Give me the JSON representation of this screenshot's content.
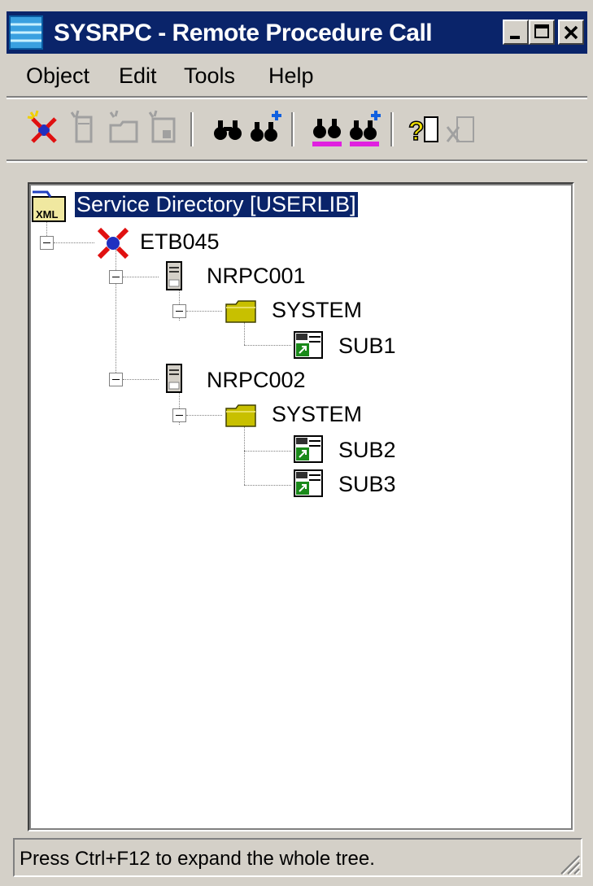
{
  "window": {
    "title": "SYSRPC - Remote Procedure Call"
  },
  "menu": {
    "items": [
      {
        "label": "Object"
      },
      {
        "label": "Edit"
      },
      {
        "label": "Tools"
      },
      {
        "label": "Help"
      }
    ]
  },
  "toolbar": {
    "buttons": [
      {
        "icon": "connect-node-icon",
        "enabled": true
      },
      {
        "icon": "new-server-icon",
        "enabled": false
      },
      {
        "icon": "new-library-icon",
        "enabled": false
      },
      {
        "icon": "new-subprogram-icon",
        "enabled": false
      },
      {
        "icon": "find-icon",
        "enabled": true
      },
      {
        "icon": "find-add-icon",
        "enabled": true
      },
      {
        "icon": "find-highlight-icon",
        "enabled": true
      },
      {
        "icon": "find-highlight-add-icon",
        "enabled": true
      },
      {
        "icon": "help-icon",
        "enabled": true
      },
      {
        "icon": "delete-icon",
        "enabled": false
      }
    ]
  },
  "tree": {
    "root": {
      "label": "Service Directory [USERLIB]",
      "icon": "xml-directory-icon",
      "selected": true
    },
    "nodes": [
      {
        "label": "ETB045",
        "icon": "broker-icon"
      },
      {
        "label": "NRPC001",
        "icon": "server-icon"
      },
      {
        "label": "SYSTEM",
        "icon": "folder-icon"
      },
      {
        "label": "SUB1",
        "icon": "subprogram-icon"
      },
      {
        "label": "NRPC002",
        "icon": "server-icon"
      },
      {
        "label": "SYSTEM",
        "icon": "folder-icon"
      },
      {
        "label": "SUB2",
        "icon": "subprogram-icon"
      },
      {
        "label": "SUB3",
        "icon": "subprogram-icon"
      }
    ]
  },
  "status": {
    "text": "Press Ctrl+F12 to expand the whole tree."
  },
  "colors": {
    "title_bar": "#0a246a",
    "window_face": "#d4d0c8",
    "folder": "#c8c000",
    "subprogram_green": "#1a8a1a",
    "broker_red": "#e01010"
  }
}
